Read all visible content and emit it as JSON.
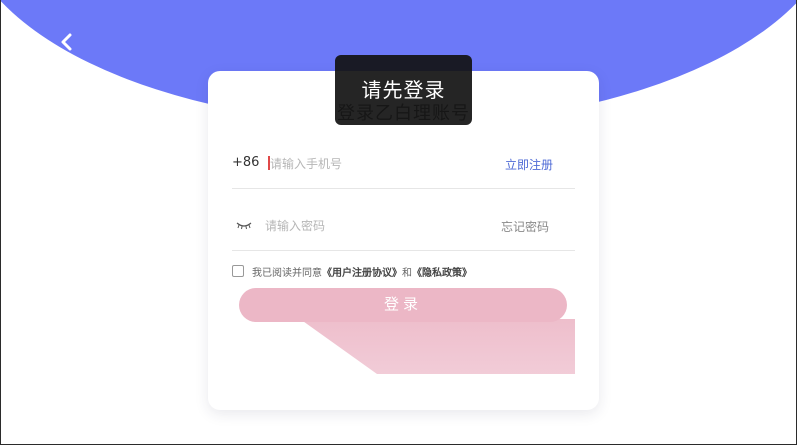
{
  "card": {
    "title": "登录乙白理账号"
  },
  "phone": {
    "country_code": "+86",
    "placeholder": "请输入手机号",
    "register_label": "立即注册"
  },
  "password": {
    "placeholder": "请输入密码",
    "forgot_label": "忘记密码"
  },
  "agreement": {
    "prefix": "我已阅读并同意",
    "user_agreement": "《用户注册协议》",
    "and": "和",
    "privacy_policy": "《隐私政策》"
  },
  "login": {
    "label": "登录"
  },
  "toast": {
    "message": "请先登录"
  },
  "colors": {
    "hero": "#6c79f8",
    "link": "#4f6bd6",
    "button": "#ecb7c6"
  },
  "icons": {
    "back": "chevron-left-icon",
    "eye": "eye-closed-icon"
  }
}
